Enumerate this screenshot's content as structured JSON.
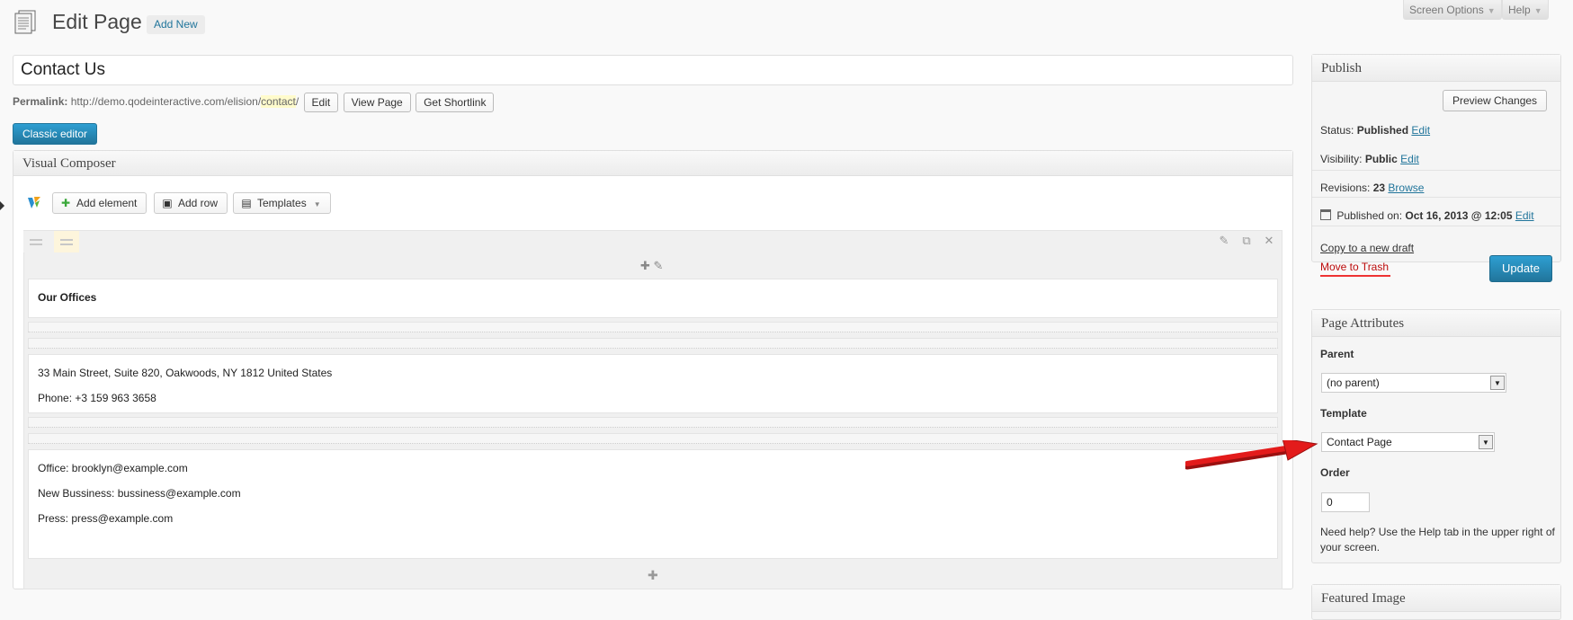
{
  "header": {
    "title": "Edit Page",
    "add_new": "Add New",
    "screen_options": "Screen Options",
    "help": "Help"
  },
  "post": {
    "title_value": "Contact Us",
    "permalink_label": "Permalink:",
    "permalink_base": "http://demo.qodeinteractive.com/elision/",
    "permalink_slug": "contact",
    "permalink_trailing": "/",
    "edit_button": "Edit",
    "view_button": "View Page",
    "shortlink_button": "Get Shortlink",
    "classic_editor": "Classic editor"
  },
  "composer": {
    "title": "Visual Composer",
    "add_element": "Add element",
    "add_row": "Add row",
    "templates": "Templates",
    "heading": "Our Offices",
    "address": "33 Main Street, Suite 820, Oakwoods, NY 1812 United States",
    "phone": "Phone: +3 159 963 3658",
    "office": "Office: brooklyn@example.com",
    "new_business": "New Bussiness: bussiness@example.com",
    "press": "Press: press@example.com"
  },
  "publish": {
    "title": "Publish",
    "preview_changes": "Preview Changes",
    "status_label": "Status:",
    "status_value": "Published",
    "visibility_label": "Visibility:",
    "visibility_value": "Public",
    "revisions_label": "Revisions:",
    "revisions_value": "23",
    "browse": "Browse",
    "published_on_label": "Published on:",
    "published_on_value": "Oct 16, 2013 @ 12:05",
    "edit": "Edit",
    "copy_draft": "Copy to a new draft",
    "move_trash": "Move to Trash",
    "update": "Update"
  },
  "page_attributes": {
    "title": "Page Attributes",
    "parent_label": "Parent",
    "parent_value": "(no parent)",
    "template_label": "Template",
    "template_value": "Contact Page",
    "order_label": "Order",
    "order_value": "0",
    "help_text": "Need help? Use the Help tab in the upper right of your screen."
  },
  "featured_image": {
    "title": "Featured Image"
  },
  "colors": {
    "primary_blue": "#21759b",
    "trash_red": "#bc0b0b",
    "annotation_arrow": "#e31b1b"
  }
}
